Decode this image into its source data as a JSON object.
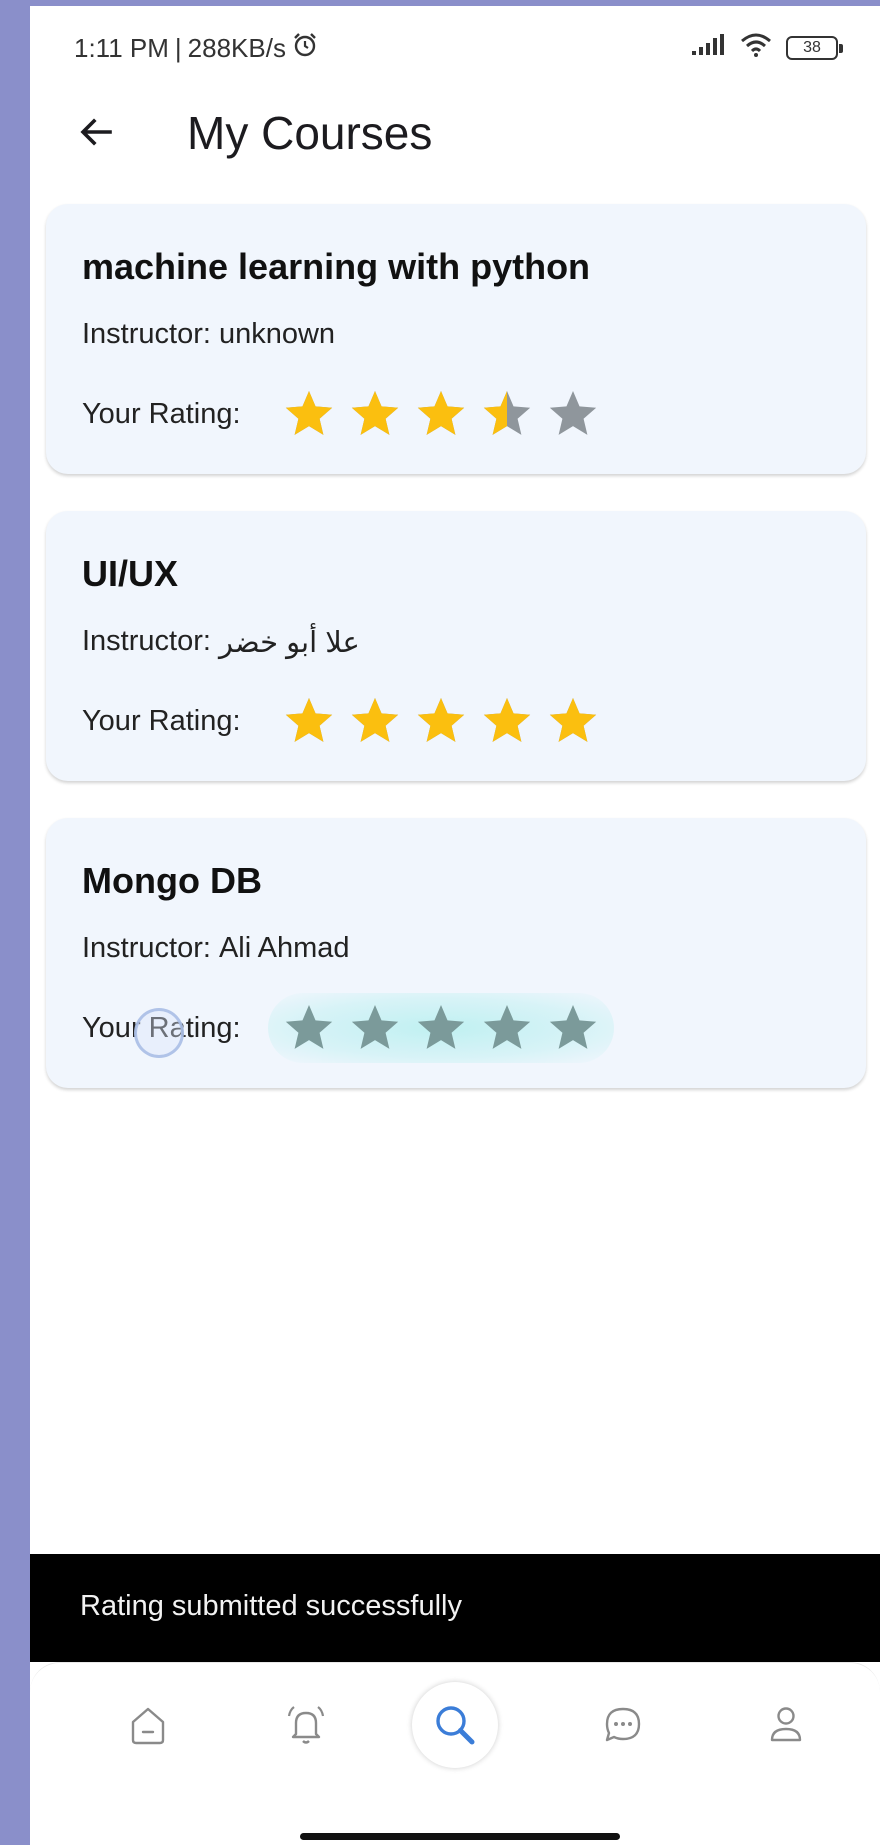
{
  "status_bar": {
    "time": "1:11 PM",
    "speed": "288KB/s",
    "battery": "38"
  },
  "app_bar": {
    "title": "My Courses"
  },
  "rating_label": "Your Rating:",
  "courses": [
    {
      "title": "machine learning with python",
      "instructor_label": "Instructor:",
      "instructor": "unknown",
      "rating": 3.5,
      "max_rating": 5
    },
    {
      "title": "UI/UX",
      "instructor_label": "Instructor:",
      "instructor": "علا أبو خضر",
      "rating": 5,
      "max_rating": 5
    },
    {
      "title": "Mongo DB",
      "instructor_label": "Instructor:",
      "instructor": "Ali Ahmad",
      "rating": 0,
      "max_rating": 5
    }
  ],
  "snackbar": {
    "message": "Rating submitted successfully"
  },
  "bottom_nav": {
    "items": [
      "home-icon",
      "bell-icon",
      "search-icon",
      "chat-icon",
      "profile-icon"
    ],
    "active": "search-icon"
  },
  "colors": {
    "star_filled": "#fbbf0f",
    "star_empty": "#8f969c",
    "star_pending": "#7b9a9a",
    "card_bg": "#f1f6fd",
    "page_border": "#8a8fca"
  }
}
